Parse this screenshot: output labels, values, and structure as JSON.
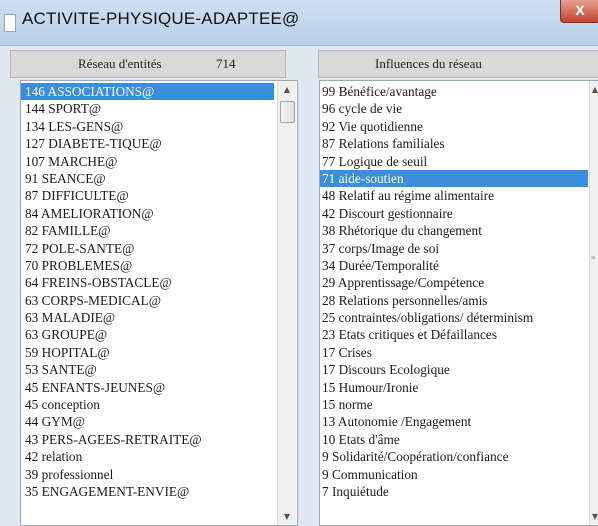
{
  "window": {
    "title": "ACTIVITE-PHYSIQUE-ADAPTEE@",
    "close_label": "X"
  },
  "left_header": {
    "label": "Réseau d'entités",
    "count": "714"
  },
  "right_header": {
    "label": "Influences du réseau"
  },
  "left_items": [
    "146  ASSOCIATIONS@",
    "144  SPORT@",
    "134  LES-GENS@",
    "127  DIABETE-TIQUE@",
    "107  MARCHE@",
    " 91  SEANCE@",
    " 87  DIFFICULTE@",
    " 84  AMELIORATION@",
    " 82  FAMILLE@",
    " 72  POLE-SANTE@",
    " 70  PROBLEMES@",
    " 64  FREINS-OBSTACLE@",
    " 63  CORPS-MEDICAL@",
    " 63  MALADIE@",
    " 63  GROUPE@",
    " 59  HOPITAL@",
    " 53  SANTE@",
    " 45  ENFANTS-JEUNES@",
    " 45  conception",
    " 44  GYM@",
    " 43  PERS-AGEES-RETRAITE@",
    " 42  relation",
    " 39  professionnel",
    " 35  ENGAGEMENT-ENVIE@"
  ],
  "right_items": [
    "99  Bénéfice/avantage",
    "96  cycle de vie",
    "92  Vie quotidienne",
    "87  Relations familiales",
    "77  Logique de seuil",
    "71  aide-soutien",
    "48  Relatif au régime alimentaire",
    "42  Discourt gestionnaire",
    "38  Rhétorique du changement",
    "37  corps/Image de soi",
    "34  Durée/Temporalité",
    "29  Apprentissage/Compétence",
    "28  Relations personnelles/amis",
    "25  contraintes/obligations/ déterminism",
    "23  Etats critiques et Défaillances",
    "17  Crises",
    "17  Discours Ecologique",
    "15  Humour/Ironie",
    "15  norme",
    "13  Autonomie /Engagement",
    "10  Etats d'âme",
    " 9  Solidarité/Coopération/confiance",
    " 9  Communication",
    " 7  Inquiétude"
  ],
  "selected_left_index": 0,
  "selected_right_index": 5,
  "icons": {
    "scroll_up": "scroll-up-arrow-icon",
    "scroll_down": "scroll-down-arrow-icon",
    "close": "close-icon"
  },
  "colors": {
    "selection": "#3a8ee0",
    "close": "#c2432e"
  }
}
